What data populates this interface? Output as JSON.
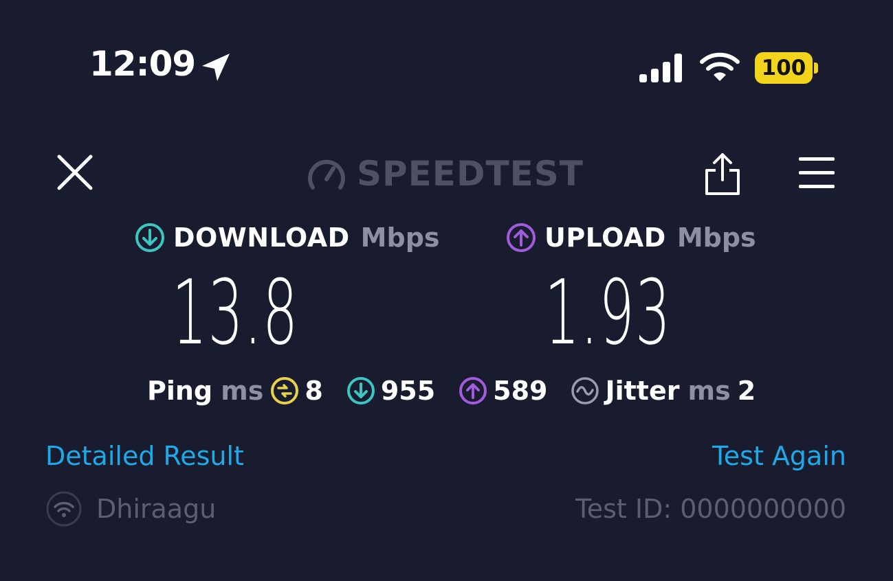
{
  "status_bar": {
    "time": "12:09",
    "battery": "100",
    "battery_color": "#f2d41c"
  },
  "header": {
    "brand": "SPEEDTEST",
    "icons": [
      "close-icon",
      "speedometer-icon",
      "share-icon",
      "menu-icon"
    ]
  },
  "download": {
    "label": "DOWNLOAD",
    "unit": "Mbps",
    "value": "13.8",
    "color": "#3cc6c2"
  },
  "upload": {
    "label": "UPLOAD",
    "unit": "Mbps",
    "value": "1.93",
    "color": "#a05cdc"
  },
  "ping": {
    "label": "Ping",
    "unit": "ms",
    "idle_value": "8",
    "download_value": "955",
    "upload_value": "589",
    "idle_color": "#e6d34a"
  },
  "jitter": {
    "label": "Jitter",
    "unit": "ms",
    "value": "2"
  },
  "links": {
    "detailed_result": "Detailed Result",
    "test_again": "Test Again",
    "color": "#1ea9e8"
  },
  "footer": {
    "provider": "Dhiraagu",
    "test_id": "Test ID: 0000000000"
  }
}
